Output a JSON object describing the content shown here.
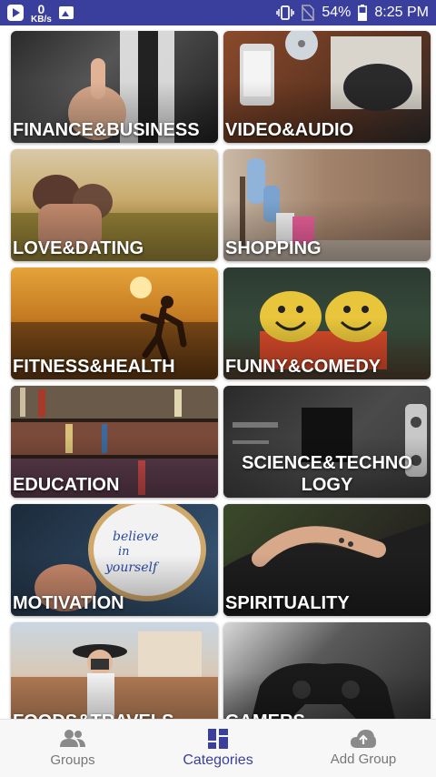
{
  "status_bar": {
    "speed_value": "0",
    "speed_unit": "KB/s",
    "battery": "54%",
    "time": "8:25 PM"
  },
  "categories": [
    {
      "label": "FINANCE&BUSINESS"
    },
    {
      "label": "VIDEO&AUDIO"
    },
    {
      "label": "LOVE&DATING"
    },
    {
      "label": "SHOPPING"
    },
    {
      "label": "FITNESS&HEALTH"
    },
    {
      "label": "FUNNY&COMEDY"
    },
    {
      "label": "EDUCATION"
    },
    {
      "label": "SCIENCE&TECHNOLOGY"
    },
    {
      "label": "MOTIVATION"
    },
    {
      "label": "SPIRITUALITY"
    },
    {
      "label": "FOODS&TRAVELS"
    },
    {
      "label": "GAMERS"
    }
  ],
  "bottom_nav": {
    "items": [
      {
        "label": "Groups",
        "icon": "people-icon"
      },
      {
        "label": "Categories",
        "icon": "dashboard-icon"
      },
      {
        "label": "Add Group",
        "icon": "cloud-upload-icon"
      }
    ],
    "active": "Categories",
    "accent_color": "#3a3f9e"
  },
  "colors": {
    "status_bar": "#3a3f9e",
    "accent": "#3a3f9e"
  }
}
